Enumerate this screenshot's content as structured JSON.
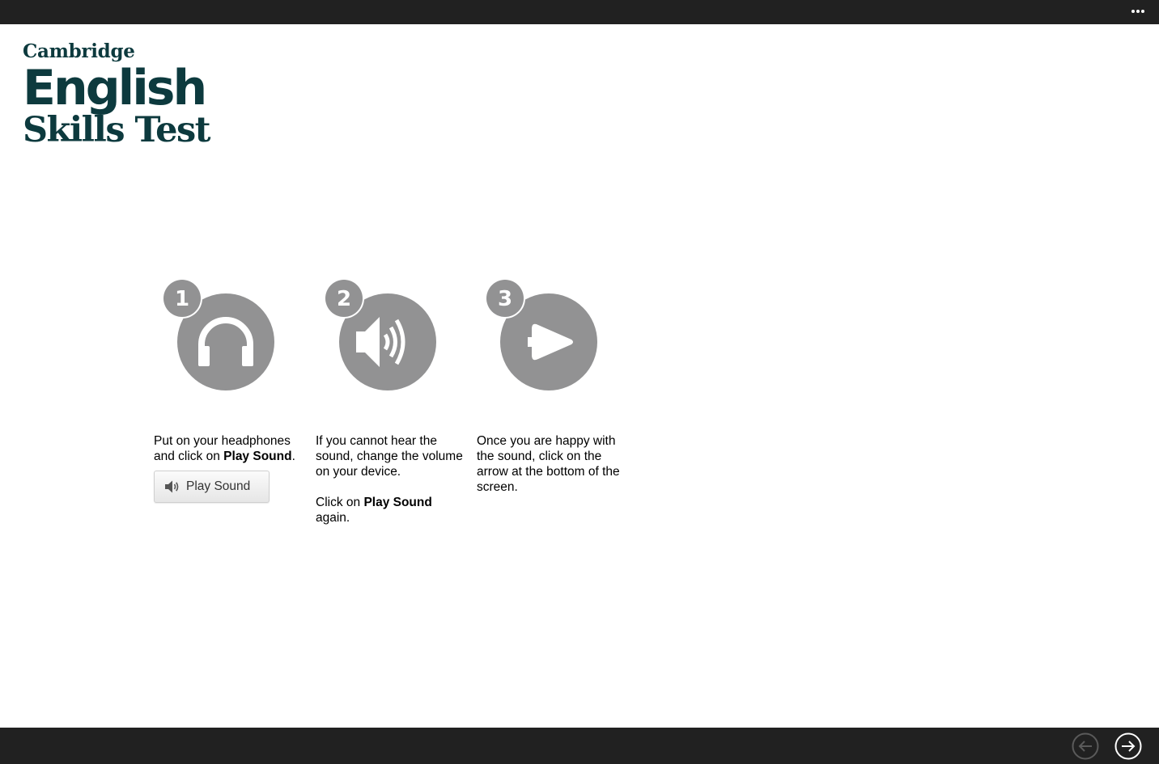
{
  "window": {
    "more_icon": "ellipsis-icon"
  },
  "logo": {
    "line1": "Cambridge",
    "line2": "English",
    "line3": "Skills Test",
    "color": "#0d3a3e"
  },
  "steps": [
    {
      "number": "1",
      "icon": "headphones-icon",
      "text_pre": "Put on your headphones and click on ",
      "text_bold": "Play Sound",
      "text_post": "."
    },
    {
      "number": "2",
      "icon": "speaker-volume-icon",
      "para1": "If you cannot hear the sound, change the volume on your device.",
      "para2_pre": "Click on ",
      "para2_bold": "Play Sound",
      "para2_post": " again."
    },
    {
      "number": "3",
      "icon": "arrow-right-icon",
      "text": "Once you are happy with the sound, click on the arrow at the bottom of the screen."
    }
  ],
  "play_button": {
    "label": "Play Sound",
    "icon": "speaker-icon"
  },
  "navigation": {
    "back_icon": "arrow-left-circle-icon",
    "next_icon": "arrow-right-circle-icon",
    "back_enabled": false,
    "next_enabled": true
  },
  "colors": {
    "bar": "#212121",
    "icon_gray": "#929293",
    "disabled": "#5a5a5a"
  }
}
